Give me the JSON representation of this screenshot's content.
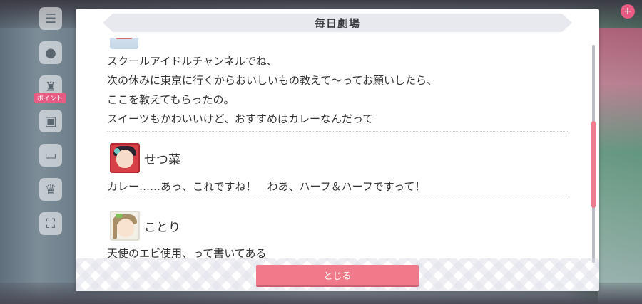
{
  "dialog": {
    "title": "毎日劇場",
    "close_label": "とじる"
  },
  "messages": [
    {
      "speaker": "",
      "lines": [
        "スクールアイドルチャンネルでね、",
        "次の休みに東京に行くからおいしいもの教えて〜ってお願いしたら、",
        "ここを教えてもらったの。",
        "スイーツもかわいいけど、おすすめはカレーなんだって"
      ]
    },
    {
      "speaker": "せつ菜",
      "lines": [
        "カレー……あっ、これですね！　わあ、ハーフ＆ハーフですって！"
      ]
    },
    {
      "speaker": "ことり",
      "lines": [
        "天使のエビ使用、って書いてある"
      ]
    }
  ],
  "side_menu": {
    "badge": "ポイント"
  },
  "colors": {
    "accent": "#f07a8a",
    "scroll_thumb": "#f07a8e"
  }
}
